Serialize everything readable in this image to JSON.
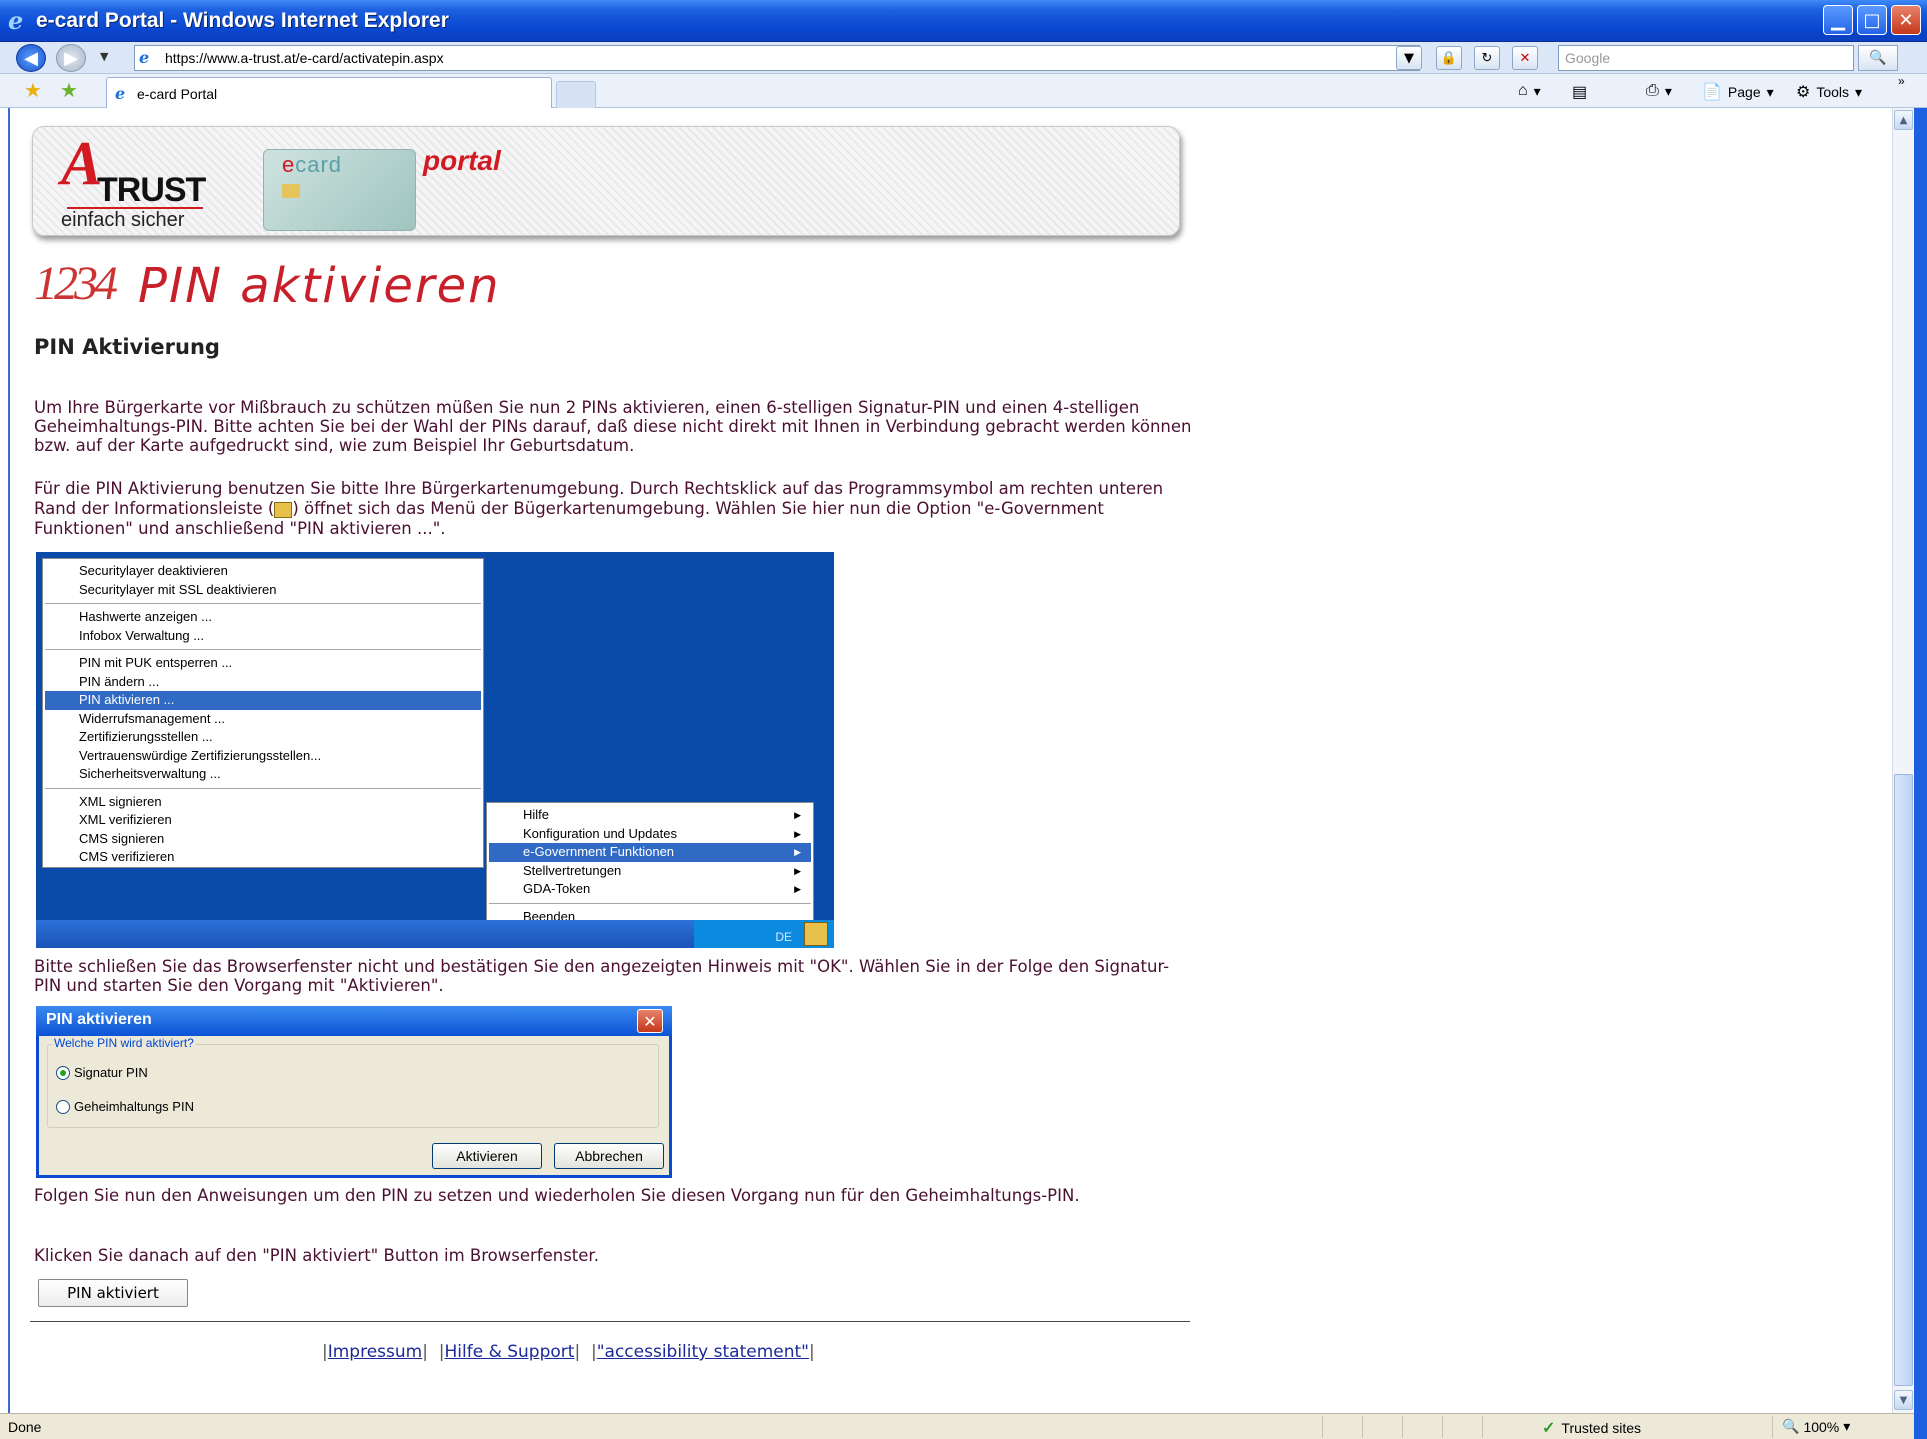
{
  "window": {
    "title": "e-card Portal - Windows Internet Explorer",
    "minimize": "▁",
    "maximize": "□",
    "close": "✕"
  },
  "nav": {
    "address": "https://www.a-trust.at/e-card/activatepin.aspx",
    "search_placeholder": "Google",
    "tab_label": "e-card Portal",
    "cmd_page": "Page",
    "cmd_tools": "Tools"
  },
  "banner": {
    "logo_a": "A",
    "logo_trust": "TRUST",
    "logo_sub": "einfach sicher",
    "ecard_e": "e",
    "ecard_rest": "card",
    "portal": "portal"
  },
  "page": {
    "heading_icon": "1234",
    "heading": "PIN aktivieren",
    "subheading": "PIN Aktivierung",
    "p1": "Um Ihre Bürgerkarte vor Mißbrauch zu schützen müßen Sie nun 2 PINs aktivieren, einen 6-stelligen Signatur-PIN und einen 4-stelligen Geheimhaltungs-PIN. Bitte achten Sie bei der Wahl der PINs darauf, daß diese nicht direkt mit Ihnen in Verbindung gebracht werden können bzw. auf der Karte aufgedruckt sind, wie zum Beispiel Ihr Geburtsdatum.",
    "p2_a": "Für die PIN Aktivierung benutzen Sie bitte Ihre Bürgerkartenumgebung. Durch Rechtsklick auf das Programmsymbol am rechten unteren Rand der Informationsleiste (",
    "p2_b": ") öffnet sich das Menü der Bügerkartenumgebung. Wählen Sie hier nun die Option \"e-Government Funktionen\" und anschließend \"PIN aktivieren ...\".",
    "p3": "Bitte schließen Sie das Browserfenster nicht und bestätigen Sie den angezeigten Hinweis mit \"OK\". Wählen Sie in der Folge den Signatur-PIN und starten Sie den Vorgang mit \"Aktivieren\".",
    "p4": "Folgen Sie nun den Anweisungen um den PIN zu setzen und wiederholen Sie diesen Vorgang nun für den Geheimhaltungs-PIN.",
    "p5": "Klicken Sie danach auf den \"PIN aktiviert\" Button im Browserfenster.",
    "pin_button": "PIN aktiviert"
  },
  "context_menu": {
    "groups": [
      [
        "Securitylayer deaktivieren",
        "Securitylayer mit SSL deaktivieren"
      ],
      [
        "Hashwerte anzeigen ...",
        "Infobox Verwaltung ..."
      ],
      [
        "PIN mit PUK entsperren ...",
        "PIN ändern ...",
        "PIN aktivieren ...",
        "Widerrufsmanagement ...",
        "Zertifizierungsstellen ...",
        "Vertrauenswürdige Zertifizierungsstellen...",
        "Sicherheitsverwaltung ..."
      ],
      [
        "XML signieren",
        "XML verifizieren",
        "CMS signieren",
        "CMS verifizieren"
      ]
    ],
    "selected": "PIN aktivieren ...",
    "submenu": [
      "Hilfe",
      "Konfiguration und Updates",
      "e-Government Funktionen",
      "Stellvertretungen",
      "GDA-Token"
    ],
    "submenu_selected": "e-Government Funktionen",
    "submenu_exit": "Beenden",
    "tray_lang": "DE"
  },
  "dialog": {
    "title": "PIN aktivieren",
    "group_label": "Welche PIN wird aktiviert?",
    "option1": "Signatur PIN",
    "option2": "Geheimhaltungs PIN",
    "selected_option": "Signatur PIN",
    "btn_activate": "Aktivieren",
    "btn_cancel": "Abbrechen"
  },
  "footer": {
    "impressum": "Impressum",
    "hilfe": "Hilfe & Support",
    "accessibility": "\"accessibility statement\""
  },
  "status": {
    "text": "Done",
    "zone": "Trusted sites",
    "zoom": "100%"
  },
  "colors": {
    "accent_red": "#c8202a",
    "body_text": "#4a1030",
    "xp_blue": "#0a47d0"
  }
}
